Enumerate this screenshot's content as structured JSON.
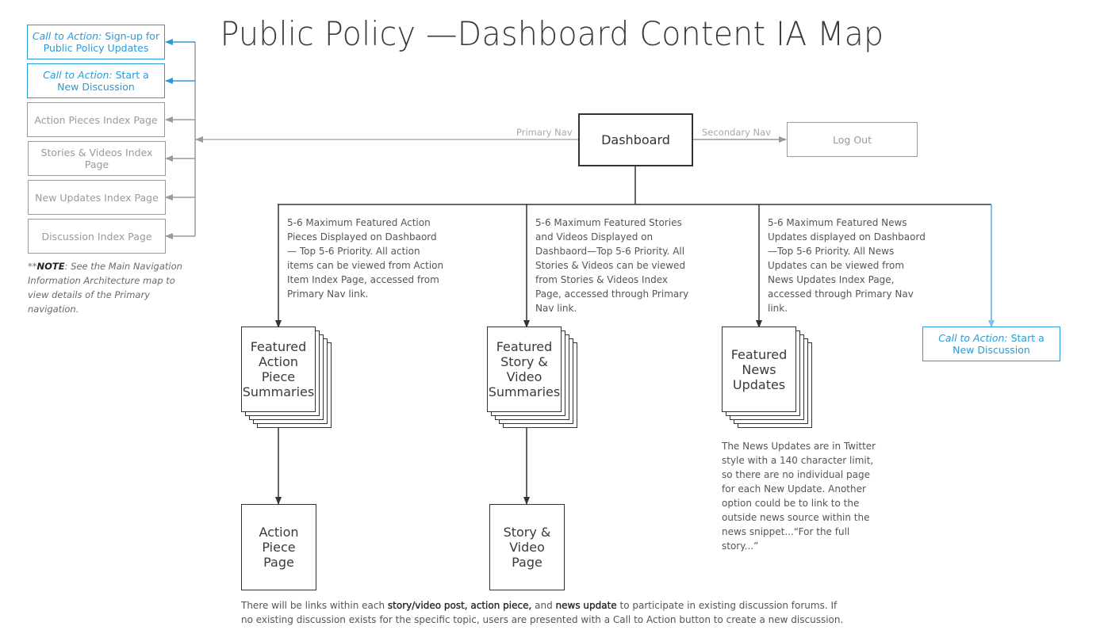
{
  "title": "Public Policy —Dashboard Content IA Map",
  "colors": {
    "accent": "#2a9ad6",
    "line_dark": "#333333",
    "line_gray": "#9a9a9a"
  },
  "left_nav": {
    "items": [
      {
        "type": "cta",
        "prefix": "Call to Action:",
        "label": " Sign-up for Public Policy Updates"
      },
      {
        "type": "cta",
        "prefix": "Call to Action:",
        "label": " Start a New Discussion"
      },
      {
        "type": "index",
        "label": "Action Pieces Index Page"
      },
      {
        "type": "index",
        "label": "Stories & Videos Index Page"
      },
      {
        "type": "index",
        "label": "New Updates Index Page"
      },
      {
        "type": "index",
        "label": "Discussion Index Page"
      }
    ],
    "note": {
      "stars": "**",
      "bold": "NOTE",
      "text": ": See the Main Navigation Information Architecture map to view details of the Primary navigation."
    }
  },
  "center": {
    "dashboard": "Dashboard",
    "primary_nav_label": "Primary Nav",
    "secondary_nav_label": "Secondary Nav",
    "logout": "Log Out"
  },
  "columns": [
    {
      "description": "5-6 Maximum Featured Action Pieces Displayed on Dashbaord— Top 5-6 Priority. All action items can be viewed from Action Item Index Page, accessed from Primary Nav link.",
      "stack_label": "Featured Action Piece Summaries",
      "page_label": "Action Piece Page"
    },
    {
      "description": "5-6 Maximum Featured Stories and Videos Displayed on Dashbaord—Top 5-6 Priority. All Stories & Videos can be viewed from Stories & Videos Index Page, accessed through Primary Nav link.",
      "stack_label": "Featured Story & Video Summaries",
      "page_label": "Story & Video Page"
    },
    {
      "description": "5-6 Maximum Featured News Updates displayed on Dashbaord —Top 5-6 Priority. All News Updates can be viewed from News Updates Index Page, accessed through Primary Nav link.",
      "stack_label": "Featured News Updates",
      "footnote": "The News Updates are in Twitter style with a 140 character limit, so there are no individual page for each New Update. Another option could be to link to the outside news source within the news snippet...“For the full story...”"
    }
  ],
  "right_cta": {
    "prefix": "Call to Action:",
    "label": " Start a New Discussion"
  },
  "footer": {
    "t1": "There will be links within each ",
    "b1": "story/video post, action piece,",
    "t2": " and ",
    "b2": "news update",
    "t3": " to participate in existing discussion forums. If no existing discussion exists for the specific topic, users are presented with a Call to Action button to create a new discussion."
  }
}
